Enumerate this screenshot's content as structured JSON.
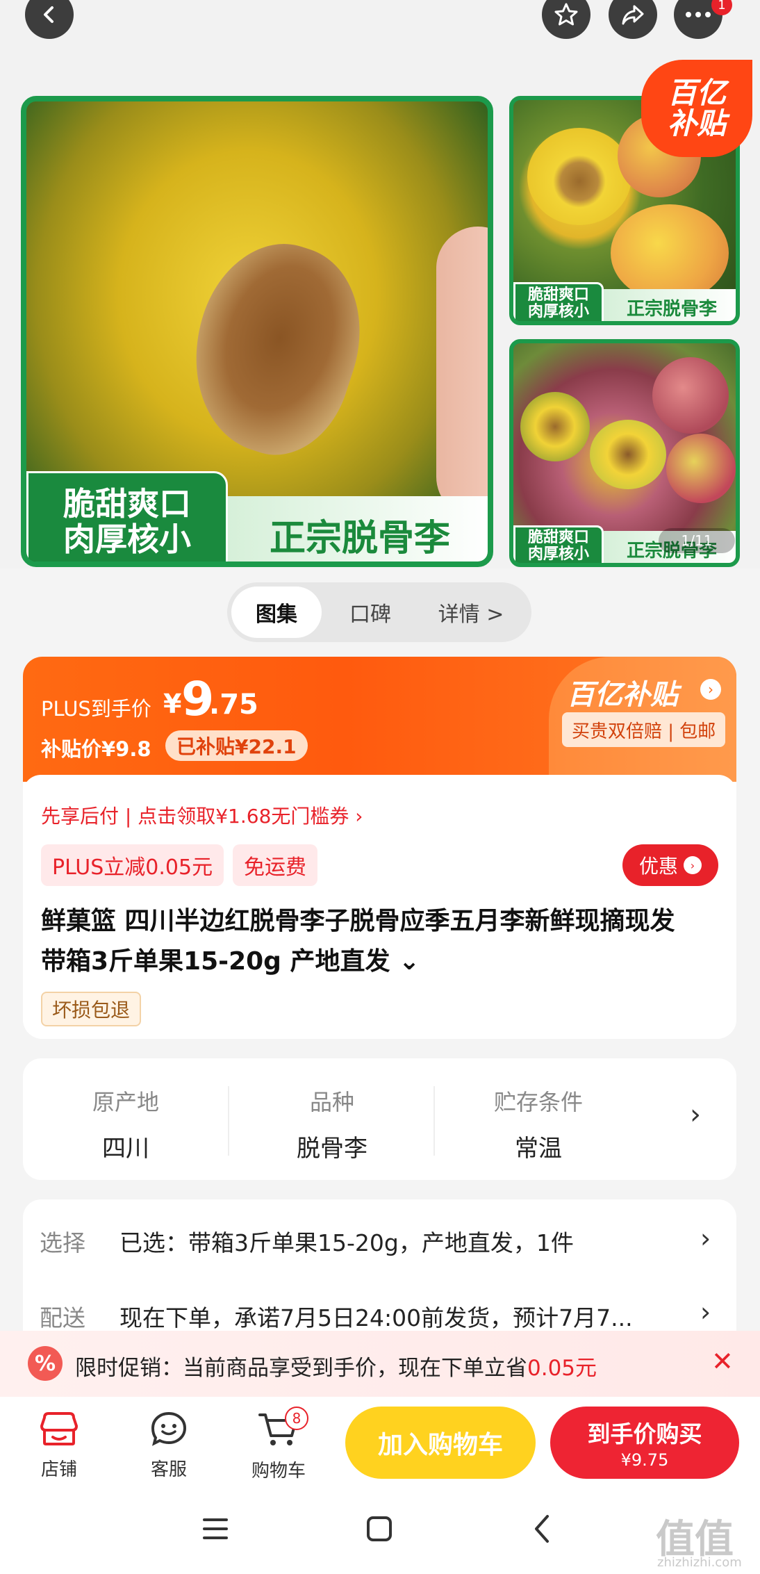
{
  "top_bar": {
    "notification_count": "1"
  },
  "gallery": {
    "main_label_left": "脆甜爽口\n肉厚核小",
    "main_label_right": "正宗脱骨李",
    "thumb1_label_left": "脆甜爽口\n肉厚核小",
    "thumb1_label_right": "正宗脱骨李",
    "thumb2_label_left": "脆甜爽口\n肉厚核小",
    "thumb2_label_right": "正宗脱骨李",
    "badge_line1": "百亿",
    "badge_line2": "补贴",
    "pager": "1/11"
  },
  "tabs": [
    "图集",
    "口碑",
    "详情 >"
  ],
  "price": {
    "plus_label": "PLUS到手价",
    "currency": "¥",
    "integer": "9",
    "decimal": ".75",
    "subsidy_price": "补贴价¥9.8",
    "subsidized": "已补贴¥22.1",
    "yizhi": "百亿补贴",
    "guarantee": "买贵双倍赔 | 包邮"
  },
  "coupon_line": "先享后付 | 点击领取¥1.68无门槛券 ›",
  "tags": {
    "plus_off": "PLUS立减0.05元",
    "free_ship": "免运费",
    "discount_button": "优惠"
  },
  "product_title": "鲜菓篮 四川半边红脱骨李子脱骨应季五月李新鲜现摘现发 带箱3斤单果15-20g 产地直发 ⌄",
  "damage_tag": "坏损包退",
  "attributes": [
    {
      "key": "原产地",
      "value": "四川"
    },
    {
      "key": "品种",
      "value": "脱骨李"
    },
    {
      "key": "贮存条件",
      "value": "常温"
    }
  ],
  "selection": {
    "select_key": "选择",
    "select_value": "已选：带箱3斤单果15-20g，产地直发，1件",
    "delivery_key": "配送",
    "delivery_value": "现在下单，承诺7月5日24:00前发货，预计7月7..."
  },
  "promo": {
    "icon": "%",
    "text": "限时促销：当前商品享受到手价，现在下单立省",
    "amount": "0.05元"
  },
  "bottom_nav": {
    "store": "店铺",
    "service": "客服",
    "cart": "购物车",
    "cart_count": "8",
    "add_to_cart": "加入购物车",
    "buy_label": "到手价购买",
    "buy_price": "¥9.75"
  },
  "watermark": {
    "main": "值值值",
    "sub": "zhizhizhi.com"
  },
  "colors": {
    "accent_red": "#e8222a",
    "orange": "#ff6a12",
    "green": "#1c9a4b",
    "yellow_button": "#ffd21f"
  }
}
